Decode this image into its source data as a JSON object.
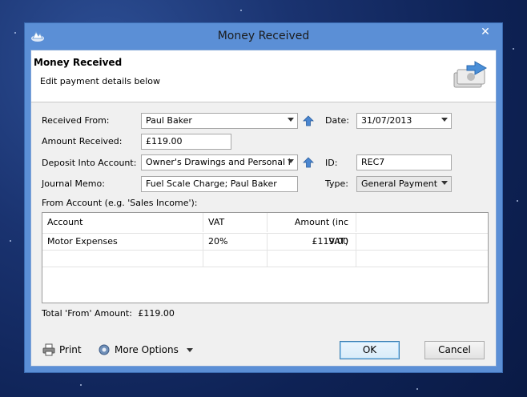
{
  "window": {
    "title": "Money Received"
  },
  "header": {
    "title": "Money Received",
    "subtitle": "Edit payment details below"
  },
  "form": {
    "received_from_label": "Received From:",
    "received_from_value": "Paul Baker",
    "date_label": "Date:",
    "date_value": "31/07/2013",
    "amount_label": "Amount Received:",
    "amount_value": "£119.00",
    "deposit_label": "Deposit Into Account:",
    "deposit_value": "Owner's Drawings and Personal I",
    "id_label": "ID:",
    "id_value": "REC7",
    "memo_label": "Journal Memo:",
    "memo_value": "Fuel Scale Charge; Paul Baker",
    "type_label": "Type:",
    "type_value": "General Payment",
    "from_account_label": "From Account (e.g. 'Sales Income'):"
  },
  "table": {
    "headers": [
      "Account",
      "VAT",
      "Amount (inc VAT)"
    ],
    "rows": [
      {
        "account": "Motor Expenses",
        "vat": "20%",
        "amount": "£119.00"
      }
    ]
  },
  "total": {
    "label": "Total 'From' Amount:",
    "value": "£119.00"
  },
  "footer": {
    "print_label": "Print",
    "more_options_label": "More Options",
    "ok_label": "OK",
    "cancel_label": "Cancel"
  }
}
